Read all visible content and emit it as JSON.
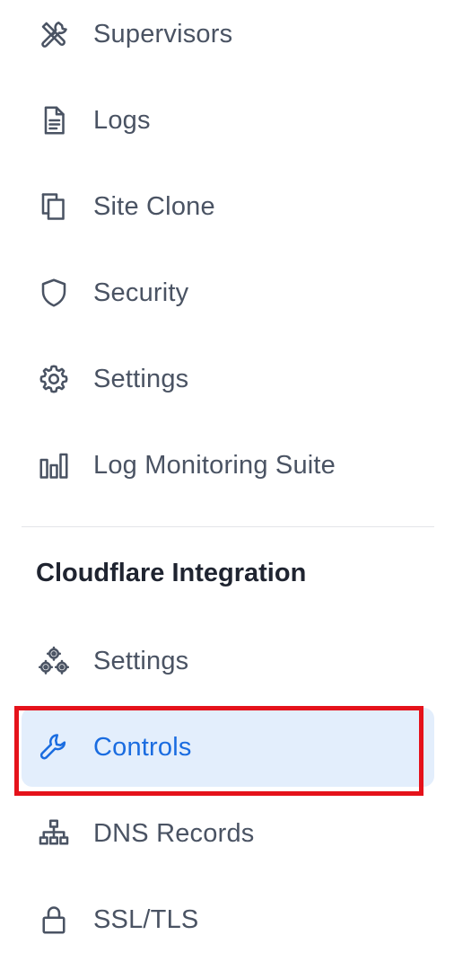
{
  "main_menu": {
    "items": [
      {
        "label": "Supervisors",
        "icon": "tools-icon"
      },
      {
        "label": "Logs",
        "icon": "document-icon"
      },
      {
        "label": "Site Clone",
        "icon": "copy-icon"
      },
      {
        "label": "Security",
        "icon": "shield-icon"
      },
      {
        "label": "Settings",
        "icon": "gear-icon"
      },
      {
        "label": "Log Monitoring Suite",
        "icon": "bar-chart-icon"
      }
    ]
  },
  "cloudflare": {
    "title": "Cloudflare Integration",
    "items": [
      {
        "label": "Settings",
        "icon": "cogs-icon"
      },
      {
        "label": "Controls",
        "icon": "wrench-icon",
        "active": true
      },
      {
        "label": "DNS Records",
        "icon": "sitemap-icon"
      },
      {
        "label": "SSL/TLS",
        "icon": "lock-icon"
      }
    ]
  },
  "colors": {
    "text": "#4a5363",
    "active_text": "#1a6ce0",
    "active_bg": "#e3eefc",
    "highlight_border": "#e5121b"
  }
}
